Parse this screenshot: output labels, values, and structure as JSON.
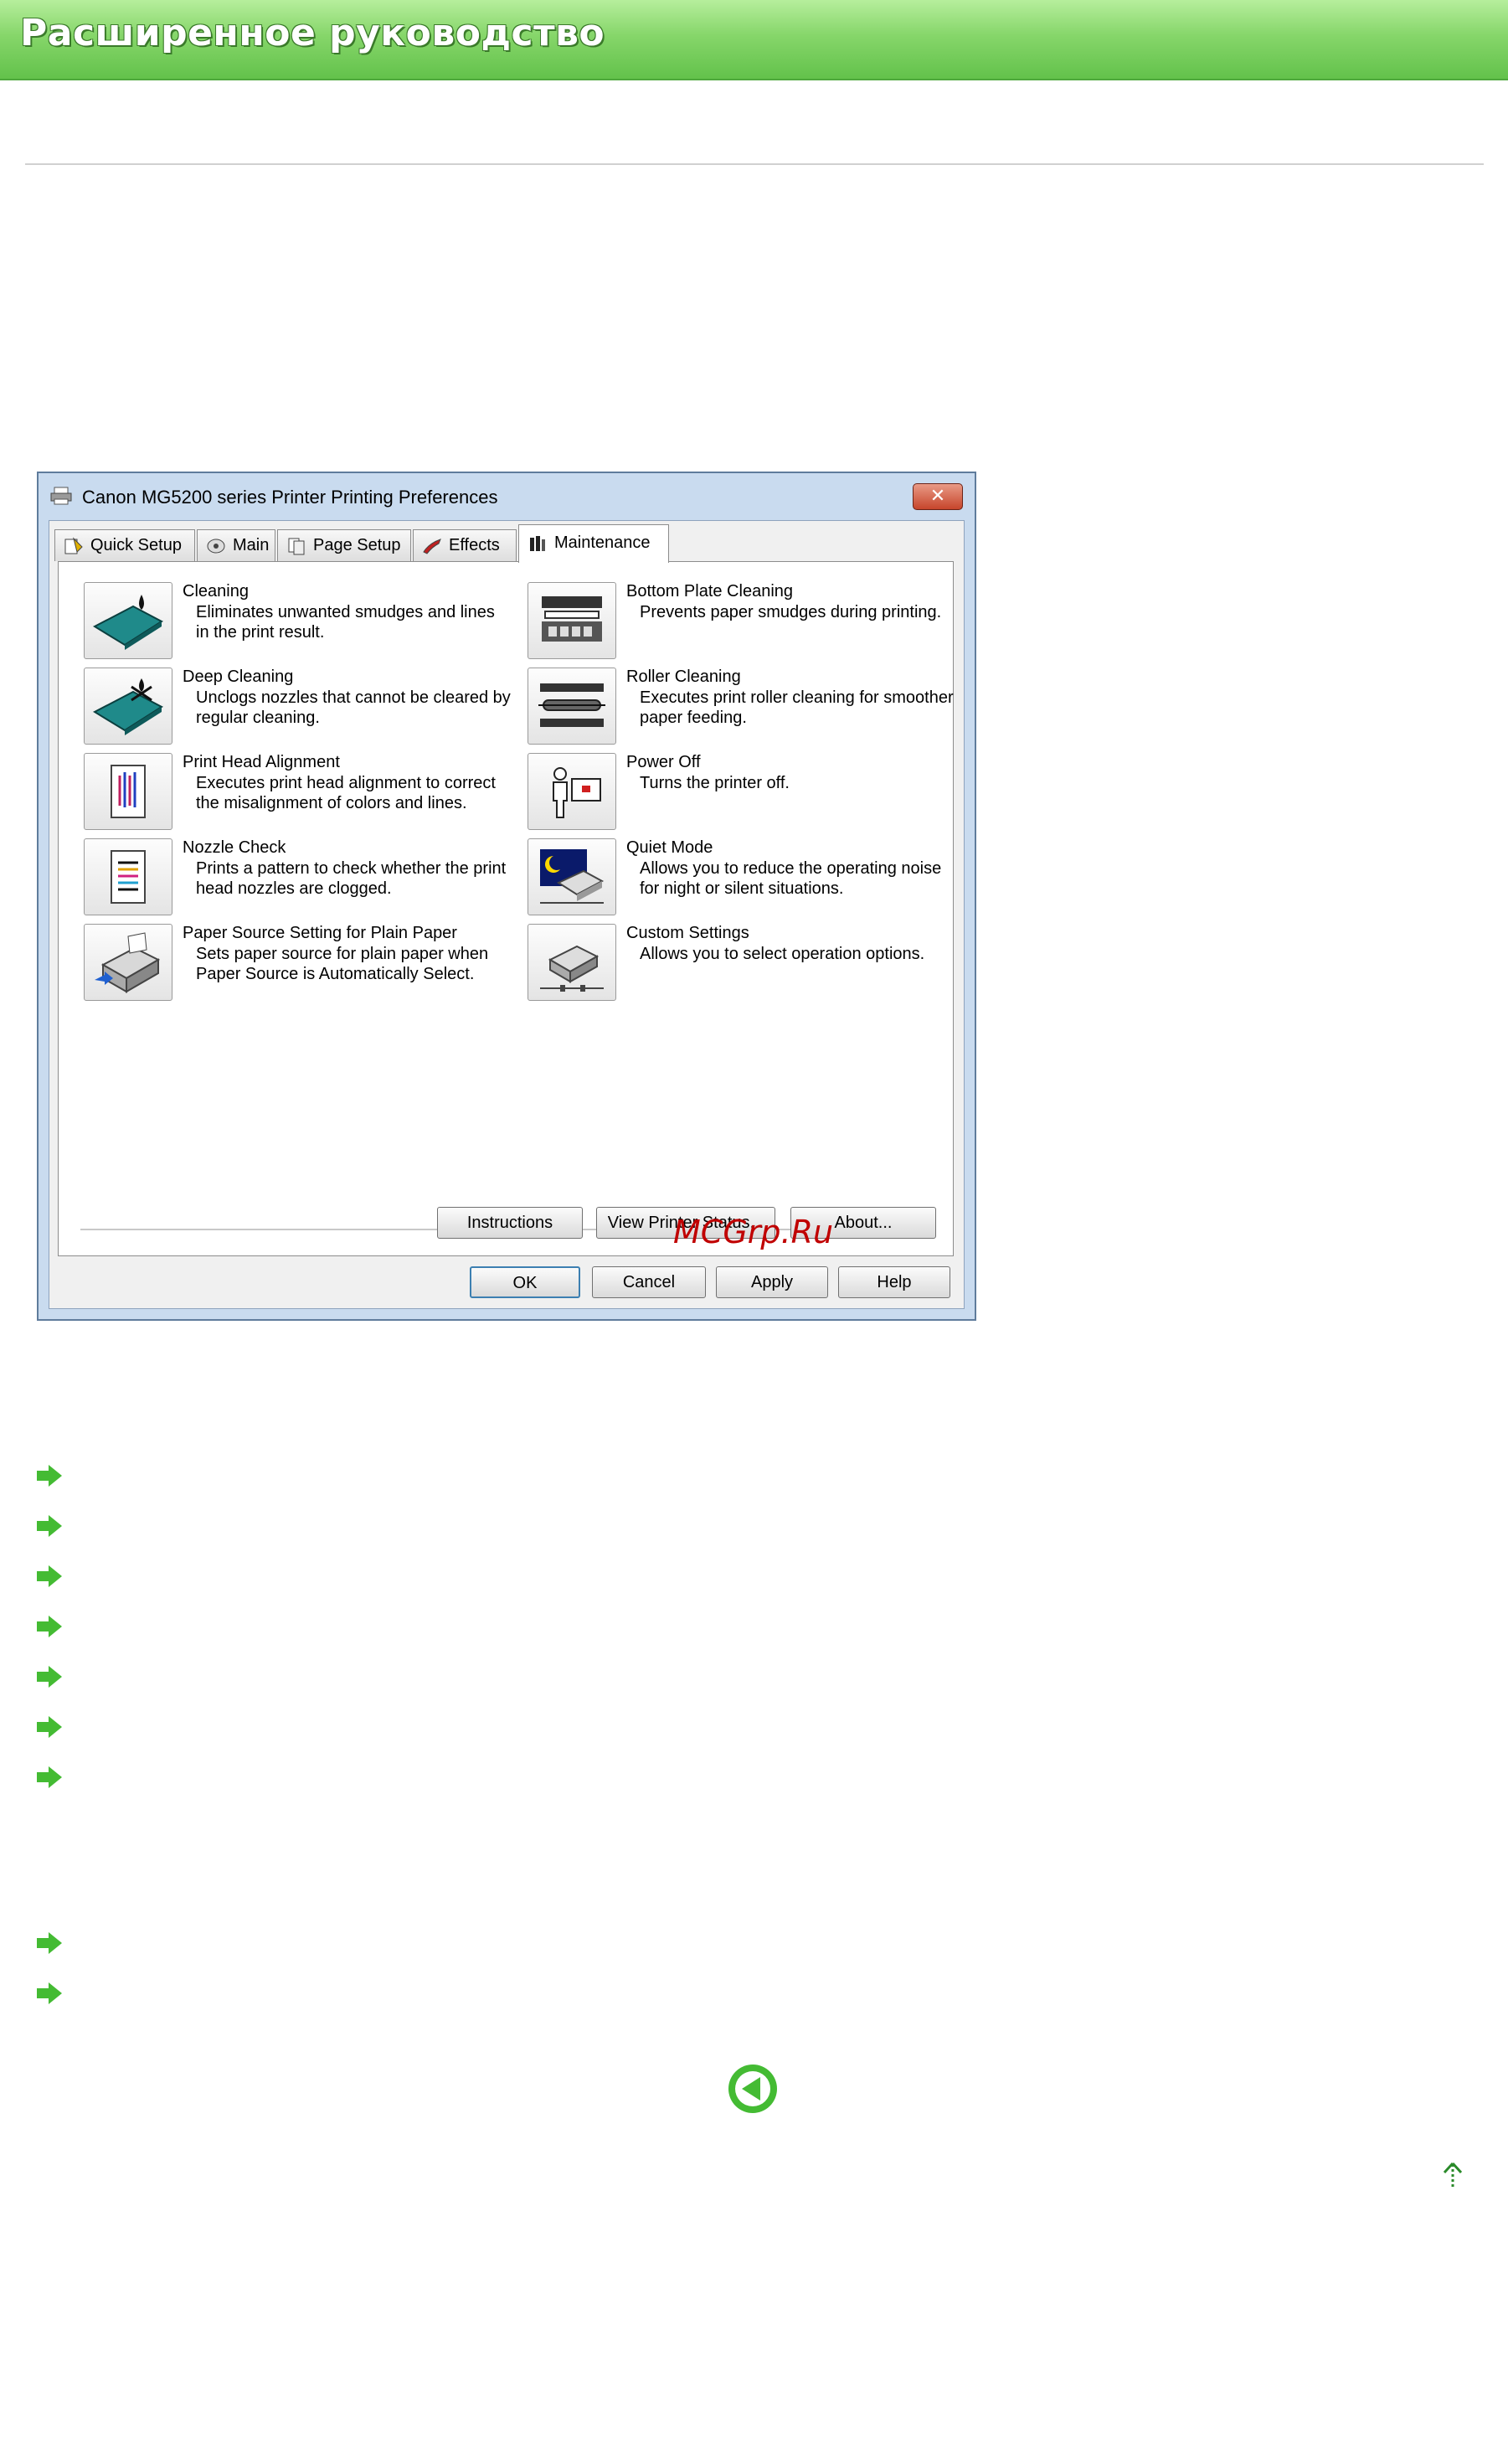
{
  "page": {
    "banner_title": "Расширенное руководство",
    "links": [
      "",
      "",
      "",
      "",
      "",
      "",
      ""
    ],
    "links_2": [
      "",
      ""
    ],
    "back_icon": "back-arrow-icon",
    "top_icon": "page-top-icon",
    "accent_color": "#63c24b"
  },
  "dialog": {
    "title": "Canon MG5200 series Printer Printing Preferences",
    "close_label": "✕",
    "tabs": [
      {
        "label": "Quick Setup",
        "icon": "quick-setup-icon"
      },
      {
        "label": "Main",
        "icon": "main-icon"
      },
      {
        "label": "Page Setup",
        "icon": "page-setup-icon"
      },
      {
        "label": "Effects",
        "icon": "effects-icon"
      },
      {
        "label": "Maintenance",
        "icon": "maintenance-icon",
        "active": true
      }
    ],
    "items_left": [
      {
        "title": "Cleaning",
        "desc": "Eliminates unwanted smudges and lines in the print result.",
        "icon": "cleaning-icon"
      },
      {
        "title": "Deep Cleaning",
        "desc": "Unclogs nozzles that cannot be cleared by regular cleaning.",
        "icon": "deep-cleaning-icon"
      },
      {
        "title": "Print Head Alignment",
        "desc": "Executes print head alignment to correct the misalignment of colors and lines.",
        "icon": "print-head-alignment-icon"
      },
      {
        "title": "Nozzle Check",
        "desc": "Prints a pattern to check whether the print head nozzles are clogged.",
        "icon": "nozzle-check-icon"
      },
      {
        "title": "Paper Source Setting for Plain Paper",
        "desc": "Sets paper source for plain paper when Paper Source is Automatically Select.",
        "icon": "paper-source-icon"
      }
    ],
    "items_right": [
      {
        "title": "Bottom Plate Cleaning",
        "desc": "Prevents paper smudges during printing.",
        "icon": "bottom-plate-cleaning-icon"
      },
      {
        "title": "Roller Cleaning",
        "desc": "Executes print roller cleaning for smoother paper feeding.",
        "icon": "roller-cleaning-icon"
      },
      {
        "title": "Power Off",
        "desc": "Turns the printer off.",
        "icon": "power-off-icon"
      },
      {
        "title": "Quiet Mode",
        "desc": "Allows you to reduce the operating noise for night or silent situations.",
        "icon": "quiet-mode-icon"
      },
      {
        "title": "Custom Settings",
        "desc": "Allows you to select operation options.",
        "icon": "custom-settings-icon"
      }
    ],
    "panel_buttons": {
      "instructions": "Instructions",
      "view_printer_status": "View Printer Status...",
      "about": "About..."
    },
    "footer_buttons": {
      "ok": "OK",
      "cancel": "Cancel",
      "apply": "Apply",
      "help": "Help"
    }
  },
  "watermark": "MCGrp.Ru"
}
